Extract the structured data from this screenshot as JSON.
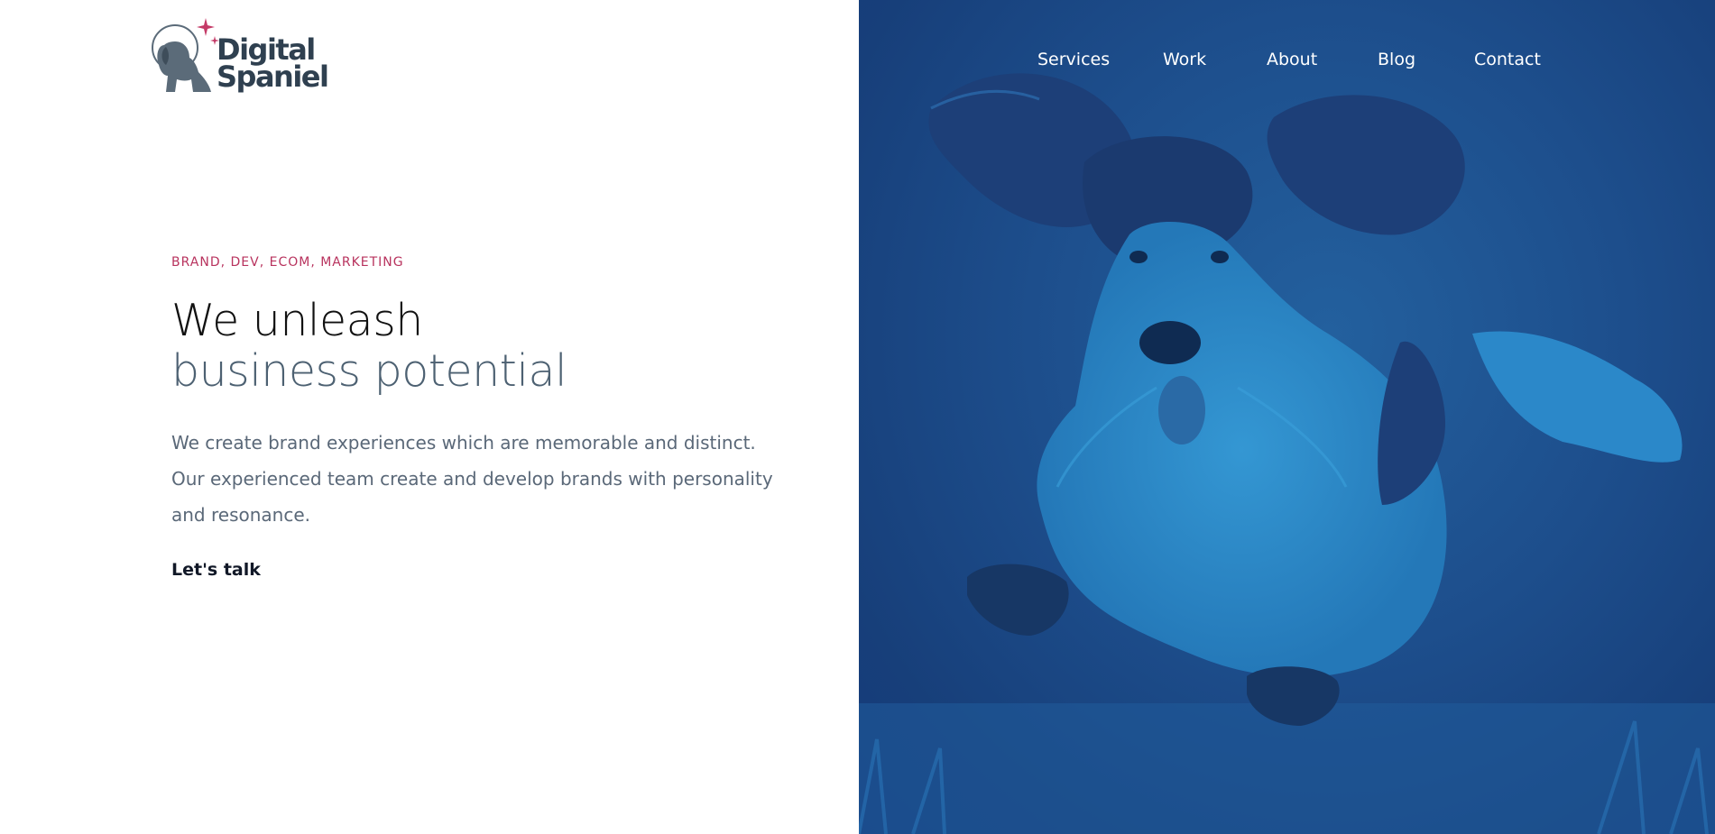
{
  "brand": {
    "name_line1": "Digital",
    "name_line2": "Spaniel",
    "logo_icon": "spaniel-astronaut-icon",
    "sparkle_icon": "sparkle-icon",
    "colors": {
      "dark": "#2f4050",
      "accent": "#b8335e",
      "hero_blue": "#1d4e8c",
      "dog_highlight": "#2e8ccb"
    }
  },
  "nav": {
    "items": [
      {
        "label": "Services"
      },
      {
        "label": "Work"
      },
      {
        "label": "About"
      },
      {
        "label": "Blog"
      },
      {
        "label": "Contact"
      }
    ]
  },
  "hero": {
    "tagline": "BRAND, DEV, ECOM, MARKETING",
    "headline_line1": "We unleash",
    "headline_line2": "business potential",
    "intro": "We create brand experiences which are memorable and distinct. Our experienced team create and develop brands with personality and resonance.",
    "cta_label": "Let's talk",
    "image": "running-spaniel-photo"
  }
}
